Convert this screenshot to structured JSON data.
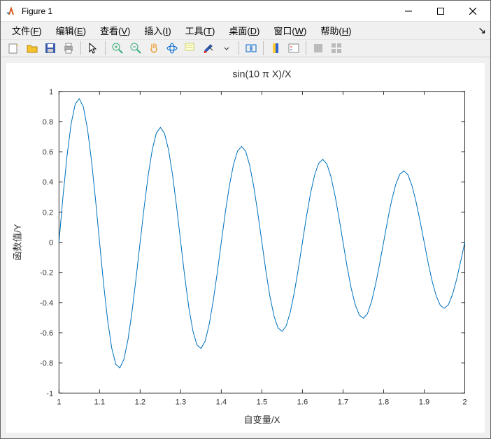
{
  "window": {
    "title": "Figure 1"
  },
  "menus": [
    {
      "label": "文件",
      "hot": "F"
    },
    {
      "label": "编辑",
      "hot": "E"
    },
    {
      "label": "查看",
      "hot": "V"
    },
    {
      "label": "插入",
      "hot": "I"
    },
    {
      "label": "工具",
      "hot": "T"
    },
    {
      "label": "桌面",
      "hot": "D"
    },
    {
      "label": "窗口",
      "hot": "W"
    },
    {
      "label": "帮助",
      "hot": "H"
    }
  ],
  "chart_data": {
    "type": "line",
    "title": "sin(10 π X)/X",
    "xlabel": "自变量/X",
    "ylabel": "函数值/Y",
    "xlim": [
      1,
      2
    ],
    "ylim": [
      -1,
      1
    ],
    "xticks": [
      1,
      1.1,
      1.2,
      1.3,
      1.4,
      1.5,
      1.6,
      1.7,
      1.8,
      1.9,
      2
    ],
    "yticks": [
      -1,
      -0.8,
      -0.6,
      -0.4,
      -0.2,
      0,
      0.2,
      0.4,
      0.6,
      0.8,
      1
    ],
    "function": "sin(10*pi*x)/x",
    "series": [
      {
        "name": "sin(10πx)/x",
        "x": [
          1,
          1.01,
          1.02,
          1.03,
          1.04,
          1.05,
          1.06,
          1.07,
          1.08,
          1.09,
          1.1,
          1.11,
          1.12,
          1.13,
          1.14,
          1.15,
          1.16,
          1.17,
          1.18,
          1.19,
          1.2,
          1.21,
          1.22,
          1.23,
          1.24,
          1.25,
          1.26,
          1.27,
          1.28,
          1.29,
          1.3,
          1.31,
          1.32,
          1.33,
          1.34,
          1.35,
          1.36,
          1.37,
          1.38,
          1.39,
          1.4,
          1.41,
          1.42,
          1.43,
          1.44,
          1.45,
          1.46,
          1.47,
          1.48,
          1.49,
          1.5,
          1.51,
          1.52,
          1.53,
          1.54,
          1.55,
          1.56,
          1.57,
          1.58,
          1.59,
          1.6,
          1.61,
          1.62,
          1.63,
          1.64,
          1.65,
          1.66,
          1.67,
          1.68,
          1.69,
          1.7,
          1.71,
          1.72,
          1.73,
          1.74,
          1.75,
          1.76,
          1.77,
          1.78,
          1.79,
          1.8,
          1.81,
          1.82,
          1.83,
          1.84,
          1.85,
          1.86,
          1.87,
          1.88,
          1.89,
          1.9,
          1.91,
          1.92,
          1.93,
          1.94,
          1.95,
          1.96,
          1.97,
          1.98,
          1.99,
          2
        ],
        "y": [
          0,
          0.306,
          0.576,
          0.786,
          0.915,
          0.952,
          0.897,
          0.756,
          0.544,
          0.284,
          0,
          -0.278,
          -0.519,
          -0.702,
          -0.809,
          -0.833,
          -0.776,
          -0.647,
          -0.46,
          -0.237,
          0,
          0.234,
          0.446,
          0.615,
          0.724,
          0.761,
          0.722,
          0.613,
          0.444,
          0.233,
          0,
          -0.231,
          -0.433,
          -0.587,
          -0.681,
          -0.704,
          -0.657,
          -0.547,
          -0.39,
          -0.203,
          0,
          0.199,
          0.375,
          0.514,
          0.604,
          0.635,
          0.603,
          0.51,
          0.369,
          0.193,
          0,
          -0.193,
          -0.361,
          -0.49,
          -0.569,
          -0.591,
          -0.554,
          -0.464,
          -0.332,
          -0.173,
          0,
          0.172,
          0.325,
          0.446,
          0.523,
          0.549,
          0.52,
          0.437,
          0.313,
          0.163,
          0,
          -0.162,
          -0.304,
          -0.414,
          -0.483,
          -0.504,
          -0.475,
          -0.396,
          -0.282,
          -0.146,
          0,
          0.148,
          0.28,
          0.384,
          0.451,
          0.473,
          0.447,
          0.374,
          0.267,
          0.138,
          0,
          -0.14,
          -0.263,
          -0.359,
          -0.42,
          -0.438,
          -0.413,
          -0.344,
          -0.245,
          -0.126,
          0
        ]
      }
    ]
  }
}
